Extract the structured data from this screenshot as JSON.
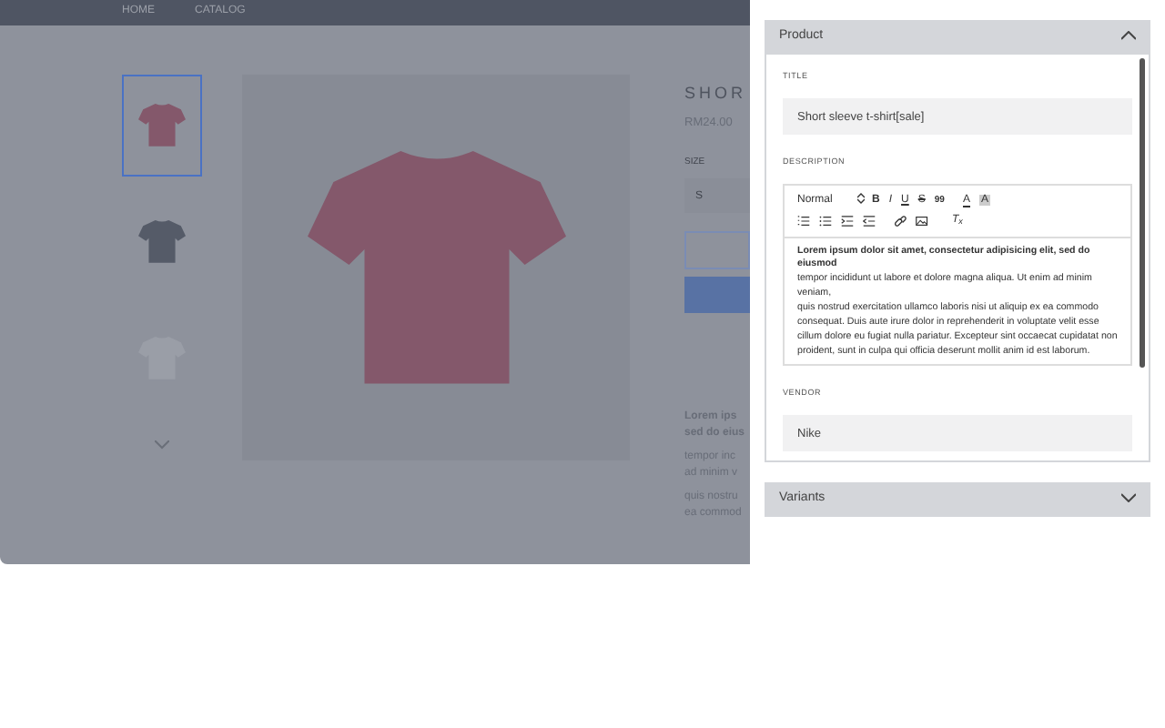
{
  "store": {
    "nav": [
      {
        "label": "HOME"
      },
      {
        "label": "CATALOG"
      }
    ],
    "thumbnails": [
      {
        "selected": true,
        "color": "#84586b"
      },
      {
        "selected": false,
        "color": "#555b68"
      },
      {
        "selected": false,
        "color": "#9a9ea7"
      }
    ],
    "product_title": "SHOR",
    "price": "RM24.00",
    "size_label": "SIZE",
    "size_value": "S",
    "description": [
      "Lorem ips",
      "sed do eius",
      "tempor inc",
      "ad minim v",
      "quis nostru",
      "ea commod"
    ]
  },
  "panel": {
    "sections": [
      {
        "title": "Product",
        "expanded": true
      },
      {
        "title": "Variants",
        "expanded": false
      }
    ],
    "title_label": "TITLE",
    "title_value": "Short sleeve t-shirt[sale]",
    "description_label": "DESCRIPTION",
    "toolbar": [
      {
        "kind": "select",
        "label": "Normal"
      },
      {
        "kind": "bold",
        "label": "B"
      },
      {
        "kind": "italic",
        "label": "I"
      },
      {
        "kind": "underline",
        "label": "U"
      },
      {
        "kind": "strike",
        "label": "S"
      },
      {
        "kind": "blockquote",
        "label": "99"
      },
      {
        "kind": "color",
        "label": "A"
      },
      {
        "kind": "background",
        "label": "A"
      },
      {
        "kind": "ordered-list"
      },
      {
        "kind": "bullet-list"
      },
      {
        "kind": "indent"
      },
      {
        "kind": "outdent"
      },
      {
        "kind": "link"
      },
      {
        "kind": "image"
      },
      {
        "kind": "clean",
        "label": "T$_{x}$"
      }
    ],
    "editor_paragraphs": [
      {
        "text": "Lorem ipsum dolor sit amet, consectetur adipisicing elit, sed do eiusmod",
        "bold": true
      },
      {
        "text": "tempor incididunt ut labore et dolore magna aliqua. Ut enim ad minim veniam,",
        "bold": false
      },
      {
        "text": "quis nostrud exercitation ullamco laboris nisi ut aliquip ex ea commodo consequat. Duis aute irure dolor in reprehenderit in voluptate velit esse cillum dolore eu fugiat nulla pariatur. Excepteur sint occaecat cupidatat non",
        "bold": false
      },
      {
        "text": "proident, sunt in culpa qui officia deserunt mollit anim id est laborum.",
        "bold": false
      }
    ],
    "vendor_label": "VENDOR",
    "vendor_value": "Nike"
  }
}
